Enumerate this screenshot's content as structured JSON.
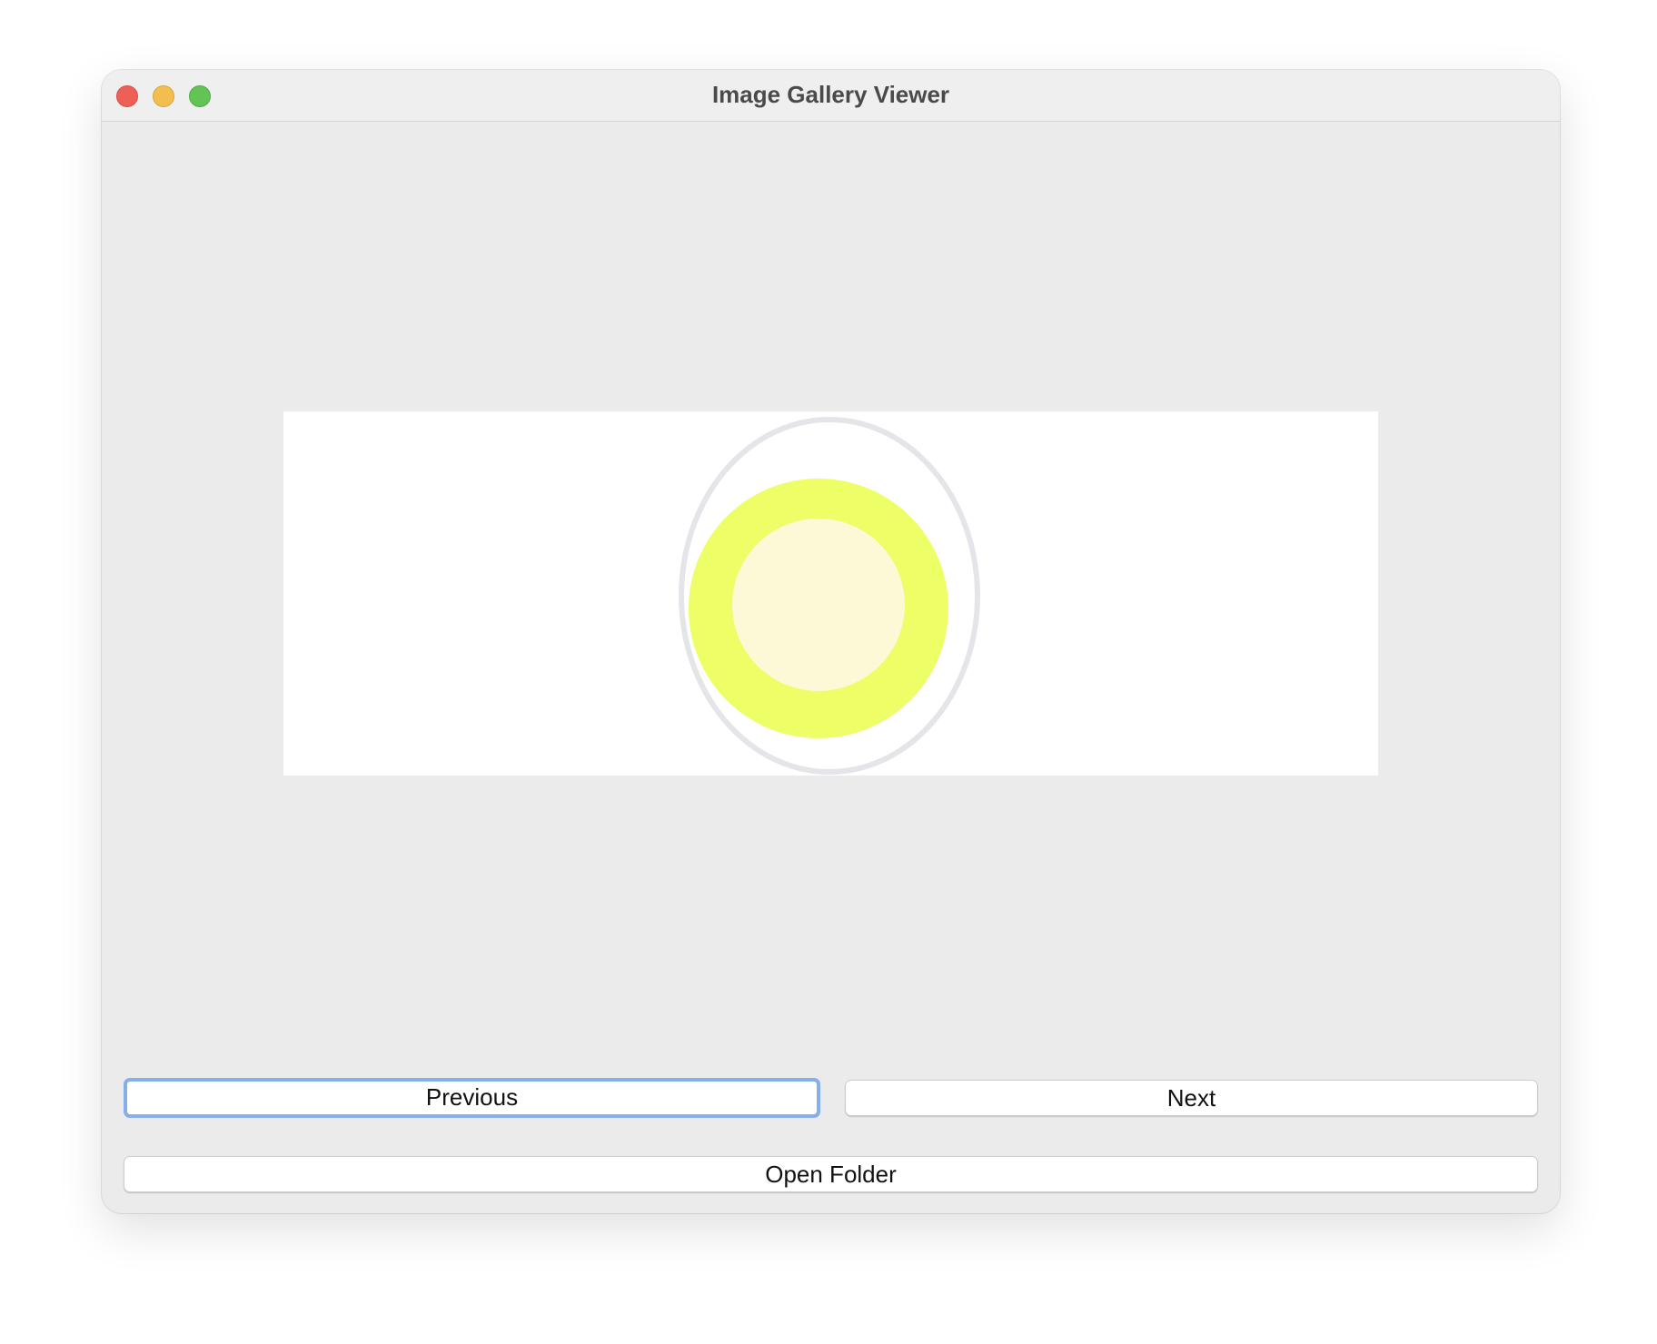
{
  "window": {
    "title": "Image Gallery Viewer"
  },
  "buttons": {
    "previous_label": "Previous",
    "next_label": "Next",
    "open_folder_label": "Open Folder"
  },
  "image": {
    "subject": "egg-illustration",
    "colors": {
      "outline": "#e3e5e8",
      "yolk_outer": "#eefe67",
      "yolk_inner": "#fdf8d6",
      "background": "#ffffff"
    }
  },
  "colors": {
    "window_background": "#ebebeb",
    "titlebar": "#efefef",
    "focus_ring": "#86aee8",
    "close": "#ee5f57",
    "minimize": "#f4bd4f",
    "maximize": "#61c454"
  }
}
